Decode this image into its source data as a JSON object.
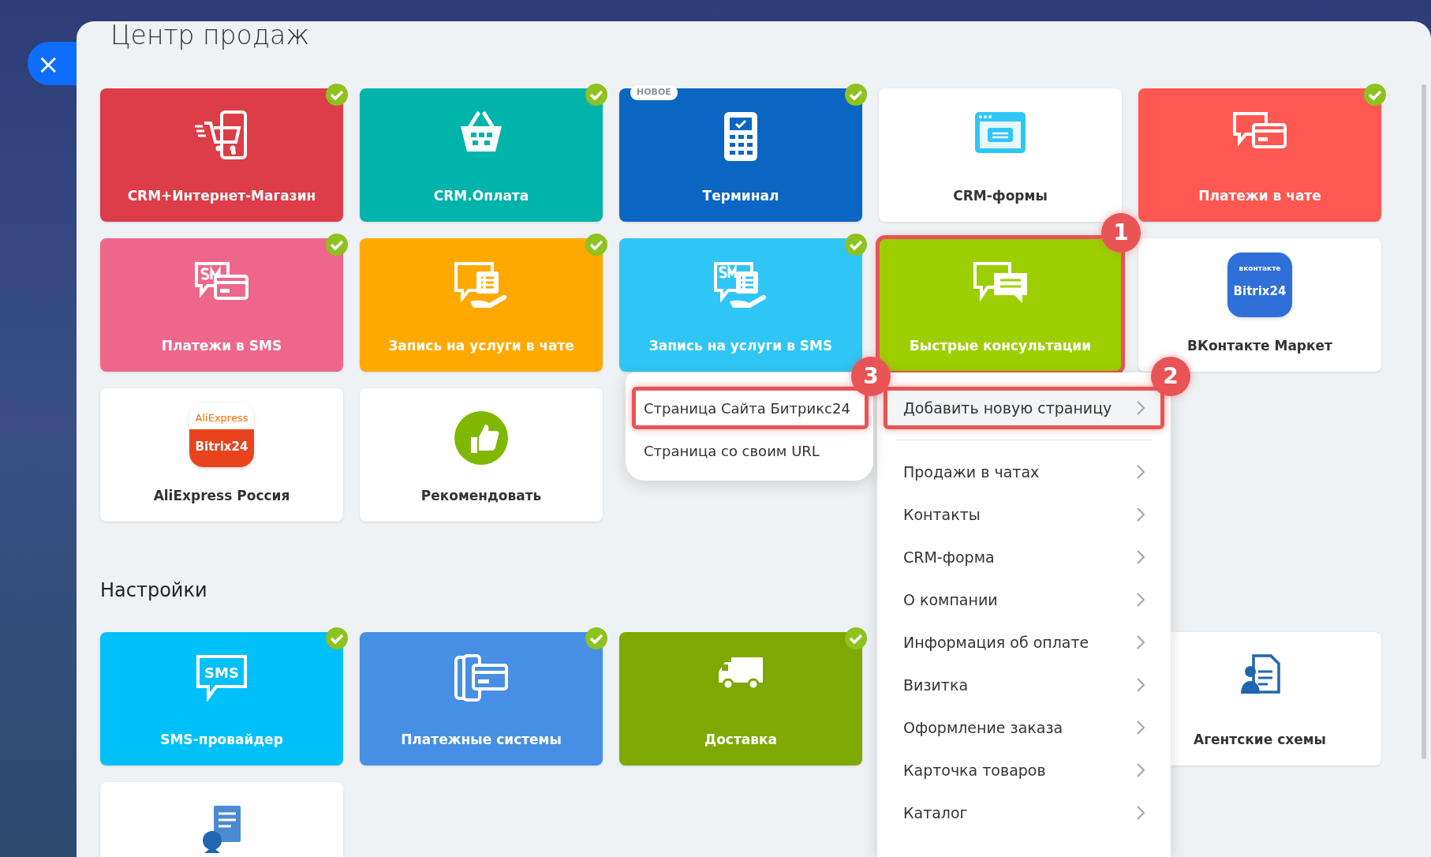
{
  "title": "Центр продаж",
  "close_button": {
    "label": "×"
  },
  "sections": [
    {
      "tiles": [
        {
          "label": "CRM+Интернет-Магазин",
          "color": "#dc3d48",
          "checked": true,
          "highlighted": false
        },
        {
          "label": "CRM.Оплата",
          "color": "#00b4ab",
          "checked": true,
          "highlighted": false
        },
        {
          "label": "Терминал",
          "color": "#0b66c3",
          "checked": true,
          "highlighted": false,
          "badge": "НОВОЕ"
        },
        {
          "label": "CRM-формы",
          "color": "#ffffff",
          "checked": false,
          "highlighted": false
        },
        {
          "label": "Платежи в чате",
          "color": "#ff5752",
          "checked": true,
          "highlighted": false
        },
        {
          "label": "Платежи в SMS",
          "color": "#ee678b",
          "checked": true,
          "highlighted": false
        },
        {
          "label": "Запись на услуги в чате",
          "color": "#ffa900",
          "checked": true,
          "highlighted": false
        },
        {
          "label": "Запись на услуги в SMS",
          "color": "#2fc6f6",
          "checked": true,
          "highlighted": false
        },
        {
          "label": "Быстрые консультации",
          "color": "#9dcf00",
          "checked": false,
          "highlighted": true,
          "callout": "1"
        },
        {
          "label": "ВКонтакте Маркет",
          "color": "#ffffff",
          "checked": false,
          "highlighted": false,
          "logo_lines": [
            "вконтакте",
            "Bitrix24"
          ]
        },
        {
          "label": "AliExpress Россия",
          "color": "#ffffff",
          "checked": false,
          "highlighted": false,
          "logo_lines": [
            "AliExpress",
            "Bitrix24"
          ]
        },
        {
          "label": "Рекомендовать",
          "color": "#ffffff",
          "checked": false,
          "highlighted": false
        }
      ]
    },
    {
      "heading": "Настройки",
      "tiles": [
        {
          "label": "SMS-провайдер",
          "color": "#00c0f9",
          "checked": true,
          "highlighted": false,
          "icon_text": "SMS"
        },
        {
          "label": "Платежные системы",
          "color": "#478fe4",
          "checked": true,
          "highlighted": false
        },
        {
          "label": "Доставка",
          "color": "#7fa800",
          "checked": true,
          "highlighted": false
        },
        {
          "kind": "hidden"
        },
        {
          "label": "Агентские схемы",
          "color": "#ffffff",
          "checked": false,
          "highlighted": false
        },
        {
          "color": "#ffffff",
          "checked": false,
          "highlighted": false
        }
      ]
    }
  ],
  "submenu": {
    "items": [
      {
        "label": "Страница Сайта Битрикс24",
        "highlighted": true,
        "callout": "3"
      },
      {
        "label": "Страница со своим URL",
        "highlighted": false
      }
    ]
  },
  "menu": {
    "items": [
      {
        "label": "Добавить новую страницу",
        "highlighted": true,
        "callout": "2"
      },
      {
        "label": "Продажи в чатах",
        "highlighted": false
      },
      {
        "label": "Контакты",
        "highlighted": false
      },
      {
        "label": "CRM-форма",
        "highlighted": false
      },
      {
        "label": "О компании",
        "highlighted": false
      },
      {
        "label": "Информация об оплате",
        "highlighted": false
      },
      {
        "label": "Визитка",
        "highlighted": false
      },
      {
        "label": "Оформление заказа",
        "highlighted": false
      },
      {
        "label": "Карточка товаров",
        "highlighted": false
      },
      {
        "label": "Каталог",
        "highlighted": false
      }
    ]
  }
}
